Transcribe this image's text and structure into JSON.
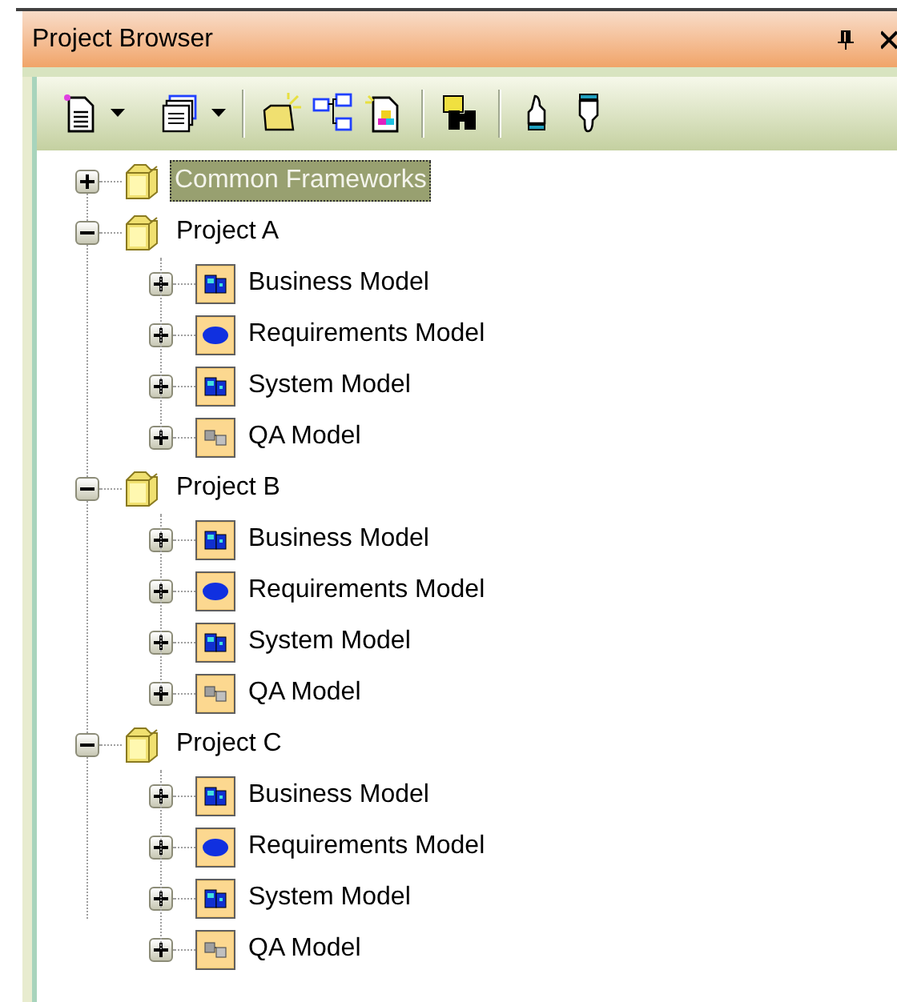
{
  "panel": {
    "title": "Project Browser"
  },
  "tree": [
    {
      "label": "Common Frameworks",
      "expanded": false,
      "selected": true
    },
    {
      "label": "Project A",
      "expanded": true,
      "selected": false,
      "children": [
        {
          "label": "Business Model",
          "kind": "business",
          "expanded": false
        },
        {
          "label": "Requirements Model",
          "kind": "requirements",
          "expanded": false
        },
        {
          "label": "System Model",
          "kind": "system",
          "expanded": false
        },
        {
          "label": "QA Model",
          "kind": "qa",
          "expanded": false
        }
      ]
    },
    {
      "label": "Project B",
      "expanded": true,
      "selected": false,
      "children": [
        {
          "label": "Business Model",
          "kind": "business",
          "expanded": false
        },
        {
          "label": "Requirements Model",
          "kind": "requirements",
          "expanded": false
        },
        {
          "label": "System Model",
          "kind": "system",
          "expanded": false
        },
        {
          "label": "QA Model",
          "kind": "qa",
          "expanded": false
        }
      ]
    },
    {
      "label": "Project C",
      "expanded": true,
      "selected": false,
      "children": [
        {
          "label": "Business Model",
          "kind": "business",
          "expanded": false
        },
        {
          "label": "Requirements Model",
          "kind": "requirements",
          "expanded": false
        },
        {
          "label": "System Model",
          "kind": "system",
          "expanded": false
        },
        {
          "label": "QA Model",
          "kind": "qa",
          "expanded": false
        }
      ]
    }
  ]
}
